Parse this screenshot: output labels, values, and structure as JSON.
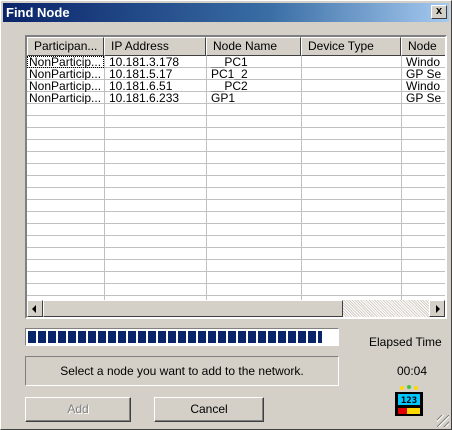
{
  "window": {
    "title": "Find Node",
    "close_glyph": "x"
  },
  "list": {
    "columns": [
      "Participan...",
      "IP Address",
      "Node Name",
      "Device Type",
      "Node"
    ],
    "rows": [
      [
        "NonParticip...",
        "10.181.3.178",
        "__PC1",
        "",
        "Windo"
      ],
      [
        "NonParticip...",
        "10.181.5.17",
        "PC1_2",
        "",
        "GP Se"
      ],
      [
        "NonParticip...",
        "10.181.6.51",
        "__PC2",
        "",
        "Windo"
      ],
      [
        "NonParticip...",
        "10.181.6.233",
        "GP1",
        "",
        "GP Se"
      ]
    ]
  },
  "progress": {
    "fraction": 0.96
  },
  "elapsed": {
    "label": "Elapsed Time",
    "value": "00:04"
  },
  "status": {
    "message": "Select a node you want to add to the network."
  },
  "buttons": {
    "add": "Add",
    "cancel": "Cancel"
  },
  "timer_icon": {
    "icon": "timer-display-icon",
    "text": "123"
  }
}
